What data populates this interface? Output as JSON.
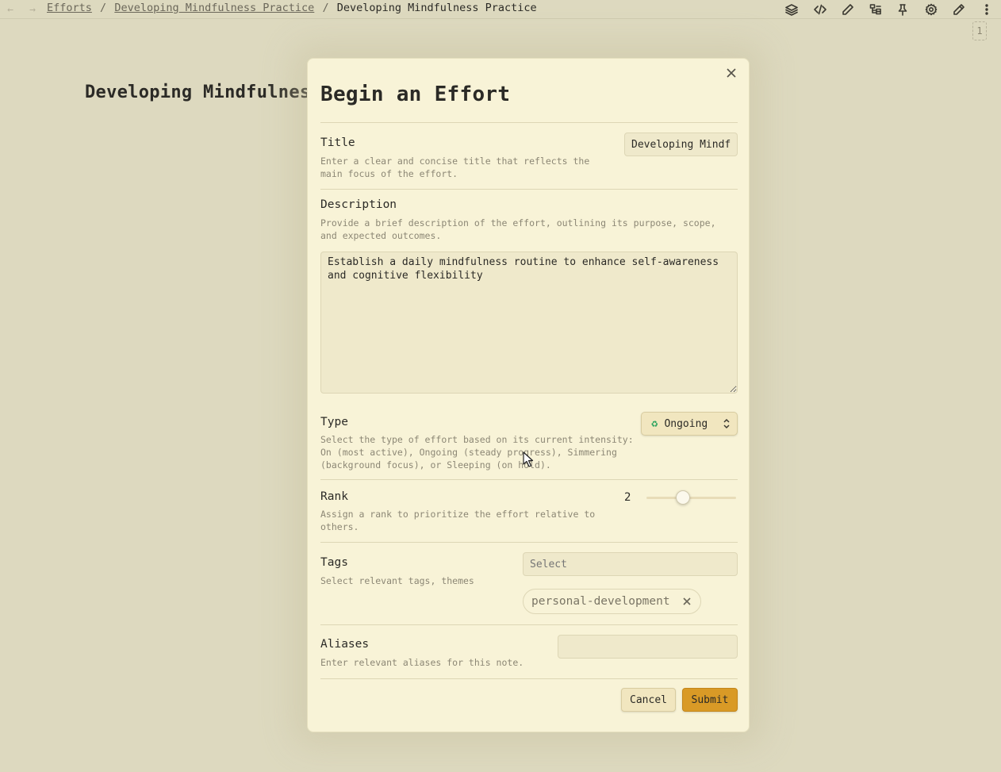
{
  "nav": {
    "back_icon": "arrow-left-icon",
    "forward_icon": "arrow-right-icon"
  },
  "breadcrumb": {
    "items": [
      "Efforts",
      "Developing Mindfulness Practice",
      "Developing Mindfulness Practice"
    ],
    "separator": "/"
  },
  "toolbar": {
    "icons": [
      "layers-icon",
      "code-icon",
      "pencil-icon",
      "tree-icon",
      "pin-icon",
      "gear-icon",
      "edit-icon",
      "more-vertical-icon"
    ]
  },
  "page_counter": "1",
  "background_title": "Developing Mindfulnes",
  "modal": {
    "title": "Begin an Effort",
    "fields": {
      "title": {
        "label": "Title",
        "description": "Enter a clear and concise title that reflects the main focus of the effort.",
        "value": "Developing Mindfulness Practice"
      },
      "description": {
        "label": "Description",
        "description": "Provide a brief description of the effort, outlining its purpose, scope, and expected outcomes.",
        "value": "Establish a daily mindfulness routine to enhance self-awareness and cognitive flexibility"
      },
      "type": {
        "label": "Type",
        "description": "Select the type of effort based on its current intensity: On (most active), Ongoing (steady progress), Simmering (background focus), or Sleeping (on hold).",
        "value": "Ongoing",
        "icon": "recycle-icon"
      },
      "rank": {
        "label": "Rank",
        "description": "Assign a rank to prioritize the effort relative to others.",
        "value": "2",
        "slider_fraction": 0.41
      },
      "tags": {
        "label": "Tags",
        "description": "Select relevant tags, themes",
        "placeholder": "Select",
        "selected": [
          "personal-development"
        ]
      },
      "aliases": {
        "label": "Aliases",
        "description": "Enter relevant aliases for this note.",
        "value": ""
      }
    },
    "buttons": {
      "cancel": "Cancel",
      "submit": "Submit"
    }
  },
  "colors": {
    "background": "#ddd9bf",
    "modal_bg": "#f8f3d7",
    "accent": "#d99a26",
    "recycle": "#22a05a"
  }
}
